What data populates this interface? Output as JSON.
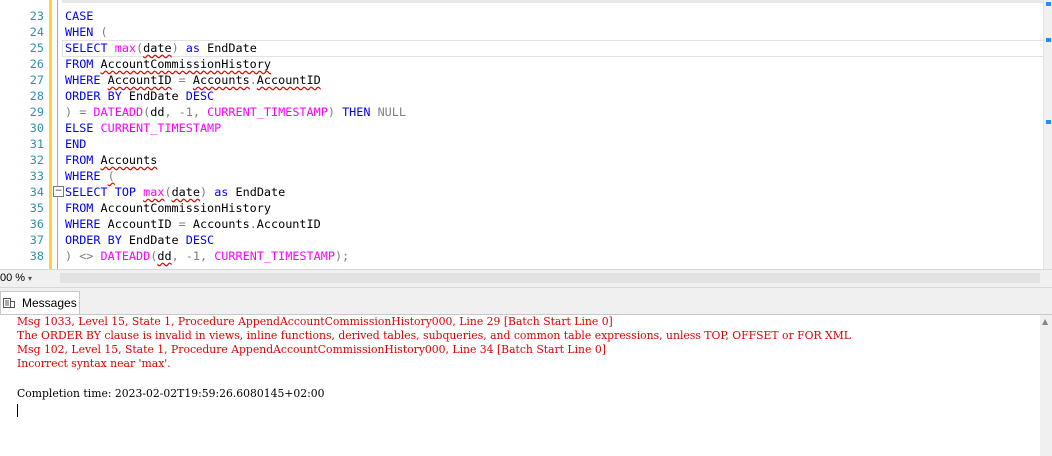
{
  "editor": {
    "lines": [
      {
        "n": "23",
        "tokens": [
          {
            "t": "CASE",
            "c": "kw"
          }
        ]
      },
      {
        "n": "24",
        "tokens": [
          {
            "t": "WHEN",
            "c": "kw"
          },
          {
            "t": " (",
            "c": "gr"
          }
        ]
      },
      {
        "n": "25",
        "tokens": [
          {
            "t": "SELECT ",
            "c": "kw"
          },
          {
            "t": "max",
            "c": "fn"
          },
          {
            "t": "(",
            "c": "gr"
          },
          {
            "t": "date",
            "c": "tx sq"
          },
          {
            "t": ") ",
            "c": "gr"
          },
          {
            "t": "as ",
            "c": "kw"
          },
          {
            "t": "EndDate",
            "c": "tx"
          }
        ]
      },
      {
        "n": "26",
        "tokens": [
          {
            "t": "FROM ",
            "c": "kw"
          },
          {
            "t": "AccountCommissionHistory",
            "c": "tx sq"
          }
        ]
      },
      {
        "n": "27",
        "tokens": [
          {
            "t": "WHERE ",
            "c": "kw"
          },
          {
            "t": "AccountID",
            "c": "tx sq"
          },
          {
            "t": " = ",
            "c": "gr"
          },
          {
            "t": "Accounts",
            "c": "tx sq"
          },
          {
            "t": ".",
            "c": "gr"
          },
          {
            "t": "AccountID",
            "c": "tx sq"
          }
        ]
      },
      {
        "n": "28",
        "tokens": [
          {
            "t": "ORDER BY ",
            "c": "kw"
          },
          {
            "t": "EndDate ",
            "c": "tx"
          },
          {
            "t": "DESC",
            "c": "kw"
          }
        ]
      },
      {
        "n": "29",
        "tokens": [
          {
            "t": ") = ",
            "c": "gr"
          },
          {
            "t": "DATEADD",
            "c": "fn"
          },
          {
            "t": "(",
            "c": "gr"
          },
          {
            "t": "dd",
            "c": "tx"
          },
          {
            "t": ", -1, ",
            "c": "gr"
          },
          {
            "t": "CURRENT_TIMESTAMP",
            "c": "fn"
          },
          {
            "t": ") ",
            "c": "gr"
          },
          {
            "t": "THEN ",
            "c": "kw"
          },
          {
            "t": "NULL",
            "c": "gr"
          }
        ]
      },
      {
        "n": "30",
        "tokens": [
          {
            "t": "ELSE ",
            "c": "kw"
          },
          {
            "t": "CURRENT_TIMESTAMP",
            "c": "fn"
          }
        ]
      },
      {
        "n": "31",
        "tokens": [
          {
            "t": "END",
            "c": "kw"
          }
        ]
      },
      {
        "n": "32",
        "tokens": [
          {
            "t": "FROM ",
            "c": "kw"
          },
          {
            "t": "Accounts",
            "c": "tx sq"
          }
        ]
      },
      {
        "n": "33",
        "tokens": [
          {
            "t": "WHERE ",
            "c": "kw"
          },
          {
            "t": "(",
            "c": "gr sq"
          }
        ]
      },
      {
        "n": "34",
        "tokens": [
          {
            "t": "SELECT ",
            "c": "kw"
          },
          {
            "t": "TOP ",
            "c": "kw"
          },
          {
            "t": "max",
            "c": "fn sq"
          },
          {
            "t": "(",
            "c": "gr"
          },
          {
            "t": "date",
            "c": "tx sq"
          },
          {
            "t": ") ",
            "c": "gr"
          },
          {
            "t": "as ",
            "c": "kw"
          },
          {
            "t": "EndDate",
            "c": "tx"
          }
        ]
      },
      {
        "n": "35",
        "tokens": [
          {
            "t": "FROM ",
            "c": "kw"
          },
          {
            "t": "AccountCommissionHistory",
            "c": "tx"
          }
        ]
      },
      {
        "n": "36",
        "tokens": [
          {
            "t": "WHERE ",
            "c": "kw"
          },
          {
            "t": "AccountID",
            "c": "tx"
          },
          {
            "t": " = ",
            "c": "gr"
          },
          {
            "t": "Accounts",
            "c": "tx"
          },
          {
            "t": ".",
            "c": "gr"
          },
          {
            "t": "AccountID",
            "c": "tx"
          }
        ]
      },
      {
        "n": "37",
        "tokens": [
          {
            "t": "ORDER BY ",
            "c": "kw"
          },
          {
            "t": "EndDate ",
            "c": "tx"
          },
          {
            "t": "DESC",
            "c": "kw"
          }
        ]
      },
      {
        "n": "38",
        "tokens": [
          {
            "t": ") <> ",
            "c": "gr"
          },
          {
            "t": "DATEADD",
            "c": "fn"
          },
          {
            "t": "(",
            "c": "gr"
          },
          {
            "t": "dd",
            "c": "tx sq"
          },
          {
            "t": ", -1, ",
            "c": "gr"
          },
          {
            "t": "CURRENT_TIMESTAMP",
            "c": "fn"
          },
          {
            "t": ");",
            "c": "gr"
          }
        ]
      }
    ],
    "fold_glyph": "−"
  },
  "status": {
    "zoom": "00 %",
    "zoom_arrow": "▾"
  },
  "results": {
    "tab_label": "Messages",
    "messages": [
      {
        "text": "Msg 1033, Level 15, State 1, Procedure AppendAccountCommissionHistory000, Line 29 [Batch Start Line 0]",
        "kind": "err"
      },
      {
        "text": "The ORDER BY clause is invalid in views, inline functions, derived tables, subqueries, and common table expressions, unless TOP, OFFSET or FOR XML",
        "kind": "err"
      },
      {
        "text": "Msg 102, Level 15, State 1, Procedure AppendAccountCommissionHistory000, Line 34 [Batch Start Line 0]",
        "kind": "err"
      },
      {
        "text": "Incorrect syntax near 'max'.",
        "kind": "err"
      },
      {
        "text": "",
        "kind": "ok"
      },
      {
        "text": "Completion time: 2023-02-02T19:59:26.6080145+02:00",
        "kind": "ok"
      }
    ]
  },
  "colors": {
    "keyword": "#0000ff",
    "function": "#ff00ff",
    "operator": "#808080",
    "error": "#e00000",
    "line_number": "#2b91af",
    "change_bar": "#ffd23c"
  }
}
